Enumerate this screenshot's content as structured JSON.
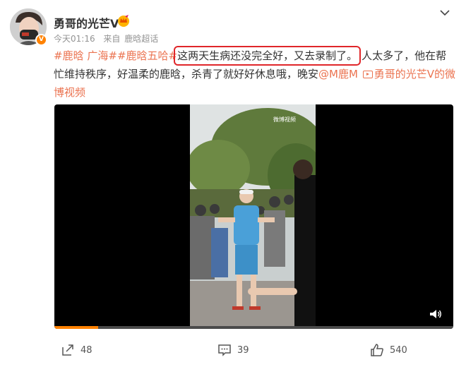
{
  "post": {
    "author": "勇哥的光芒V",
    "time": "今天01:16",
    "source_prefix": "来自",
    "source": "鹿晗超话",
    "tag1": "#鹿晗",
    "tag2": "广海#",
    "tag3": "#鹿晗五哈#",
    "highlight": "这两天生病还没完全好，又去录制了。",
    "body": "人太多了，他在帮忙维持秩序，好温柔的鹿晗，杀青了就好好休息哦，晚安",
    "mention": "@M鹿M",
    "video_link": "勇哥的光芒V的微博视频",
    "watermark": "微博视频"
  },
  "video": {
    "progress_fraction": 0.11
  },
  "actions": {
    "reposts": "48",
    "comments": "39",
    "likes": "540"
  },
  "icons": {
    "expand": "chevron-down-icon",
    "verified": "verified-v-icon",
    "crown": "crown-badge-icon",
    "repost": "repost-icon",
    "comment": "comment-icon",
    "like": "thumbs-up-icon",
    "volume": "volume-icon"
  },
  "colors": {
    "accent": "#eb7350",
    "highlight_box": "#e0262a",
    "progress": "#ff8200"
  }
}
